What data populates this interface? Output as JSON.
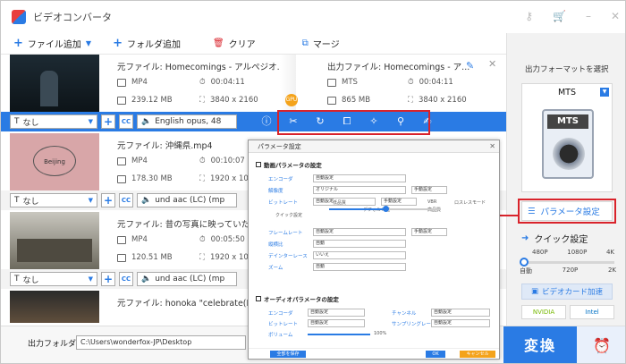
{
  "app": {
    "title": "ビデオコンバータ"
  },
  "toolbar": {
    "add_file": "ファイル追加",
    "add_folder": "フォルダ追加",
    "clear": "クリア",
    "merge": "マージ"
  },
  "files": [
    {
      "source": "元ファイル: Homecomings - アルペジオ...",
      "format": "MP4",
      "duration": "00:04:11",
      "size": "239.12 MB",
      "resolution": "3840 x 2160",
      "output": "出力ファイル: Homecomings - ア...",
      "out_format": "MTS",
      "out_duration": "00:04:11",
      "out_size": "865 MB",
      "out_resolution": "3840 x 2160",
      "subtitle": "なし",
      "audio": "English opus, 48"
    },
    {
      "source": "元ファイル: 沖縄県.mp4",
      "format": "MP4",
      "duration": "00:10:07",
      "size": "178.30 MB",
      "resolution": "1920 x 10",
      "subtitle": "なし",
      "audio": "und aac (LC) (mp",
      "thumb_text": "Beijing"
    },
    {
      "source": "元ファイル: 昔の写真に映っていたあ",
      "format": "MP4",
      "duration": "00:05:50",
      "size": "120.51 MB",
      "resolution": "1920 x 10",
      "subtitle": "なし",
      "audio": "und aac (LC) (mp"
    },
    {
      "source": "元ファイル: honoka \"celebrate(Proc"
    }
  ],
  "gpu_label": "GPU",
  "right_panel": {
    "select_format": "出力フォーマットを選択",
    "format": "MTS",
    "format_badge": "MTS",
    "param_button": "パラメータ設定",
    "quick_setting": "クイック設定",
    "quality_top": [
      "480P",
      "1080P",
      "4K"
    ],
    "quality_bottom": [
      "自動",
      "720P",
      "2K"
    ],
    "gpu_accel": "ビデオカード加速",
    "vendors": [
      "NVIDIA",
      "Intel"
    ]
  },
  "bottom": {
    "out_folder_label": "出力フォルダ:",
    "out_path": "C:\\Users\\wonderfox-JP\\Desktop",
    "convert": "変換"
  },
  "dialog": {
    "title": "パラメータ設定",
    "video_section": "動画パラメータの設定",
    "audio_section": "オーディオパラメータの設定",
    "video_rows": [
      {
        "label": "エンコーダ",
        "value": "自動設定"
      },
      {
        "label": "解像度",
        "value": "オリジナル",
        "button": "手動設定"
      },
      {
        "label": "ビットレート",
        "value": "自動設定",
        "button": "手動設定",
        "extra1": "VBR",
        "extra2": "ロスレスモード"
      },
      {
        "label": "フレームレート",
        "value": "自動設定",
        "button": "手動設定"
      },
      {
        "label": "縦横比",
        "value": "自動"
      },
      {
        "label": "デインターレース",
        "value": "いいえ"
      },
      {
        "label": "ズーム",
        "value": "自動"
      }
    ],
    "quality_label": "クイック設定",
    "slider_low": "低品質",
    "slider_default": "デフォルト値",
    "slider_high": "高品質",
    "audio_rows": [
      {
        "label": "エンコーダ",
        "value": "自動設定",
        "label2": "チャンネル",
        "value2": "自動設定"
      },
      {
        "label": "ビットレート",
        "value": "自動設定",
        "label2": "サンプリングレート",
        "value2": "自動設定"
      },
      {
        "label": "ボリューム",
        "value": "100%"
      }
    ],
    "footer_left": "全部を保存",
    "ok": "OK",
    "cancel": "キャンセル"
  }
}
